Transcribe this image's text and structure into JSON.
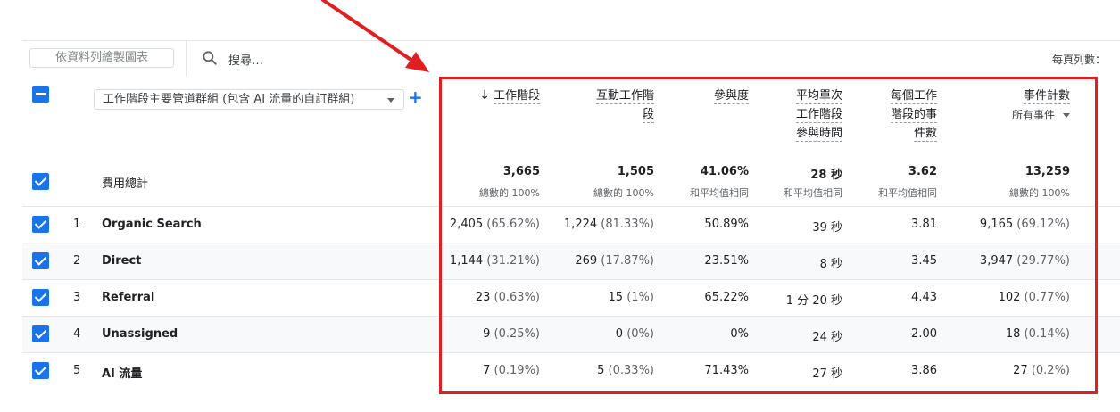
{
  "toolbar": {
    "chart_button": "依資料列繪製圖表",
    "search_placeholder": "搜尋…",
    "rows_per_page_label": "每頁列數："
  },
  "dimension": {
    "selector_label": "工作階段主要管道群組 (包含 AI 流量的自訂群組)",
    "add_label": "+"
  },
  "columns": [
    {
      "lines": [
        "工作階段"
      ],
      "sorted": true
    },
    {
      "lines": [
        "互動工作階",
        "段"
      ]
    },
    {
      "lines": [
        "參與度"
      ]
    },
    {
      "lines": [
        "平均單次",
        "工作階段",
        "參與時間"
      ]
    },
    {
      "lines": [
        "每個工作",
        "階段的事",
        "件數"
      ]
    },
    {
      "lines": [
        "事件計數"
      ],
      "sub": "所有事件"
    }
  ],
  "totals": {
    "label": "費用總計",
    "values": [
      "3,665",
      "1,505",
      "41.06%",
      "28 秒",
      "3.62",
      "13,259"
    ],
    "subs": [
      "總數的 100%",
      "總數的 100%",
      "和平均值相同",
      "和平均值相同",
      "和平均值相同",
      "總數的 100%"
    ]
  },
  "rows": [
    {
      "index": "1",
      "name": "Organic Search",
      "cells": [
        [
          "2,405",
          "(65.62%)"
        ],
        [
          "1,224",
          "(81.33%)"
        ],
        [
          "50.89%",
          ""
        ],
        [
          "39 秒",
          ""
        ],
        [
          "3.81",
          ""
        ],
        [
          "9,165",
          "(69.12%)"
        ]
      ]
    },
    {
      "index": "2",
      "name": "Direct",
      "cells": [
        [
          "1,144",
          "(31.21%)"
        ],
        [
          "269",
          "(17.87%)"
        ],
        [
          "23.51%",
          ""
        ],
        [
          "8 秒",
          ""
        ],
        [
          "3.45",
          ""
        ],
        [
          "3,947",
          "(29.77%)"
        ]
      ]
    },
    {
      "index": "3",
      "name": "Referral",
      "cells": [
        [
          "23",
          "(0.63%)"
        ],
        [
          "15",
          "(1%)"
        ],
        [
          "65.22%",
          ""
        ],
        [
          "1 分 20 秒",
          ""
        ],
        [
          "4.43",
          ""
        ],
        [
          "102",
          "(0.77%)"
        ]
      ]
    },
    {
      "index": "4",
      "name": "Unassigned",
      "cells": [
        [
          "9",
          "(0.25%)"
        ],
        [
          "0",
          "(0%)"
        ],
        [
          "0%",
          ""
        ],
        [
          "24 秒",
          ""
        ],
        [
          "2.00",
          ""
        ],
        [
          "18",
          "(0.14%)"
        ]
      ]
    },
    {
      "index": "5",
      "name": "AI 流量",
      "cells": [
        [
          "7",
          "(0.19%)"
        ],
        [
          "5",
          "(0.33%)"
        ],
        [
          "71.43%",
          ""
        ],
        [
          "27 秒",
          ""
        ],
        [
          "3.86",
          ""
        ],
        [
          "27",
          "(0.2%)"
        ]
      ]
    }
  ],
  "colors": {
    "accent": "#1a73e8",
    "annotation": "#e02020"
  }
}
